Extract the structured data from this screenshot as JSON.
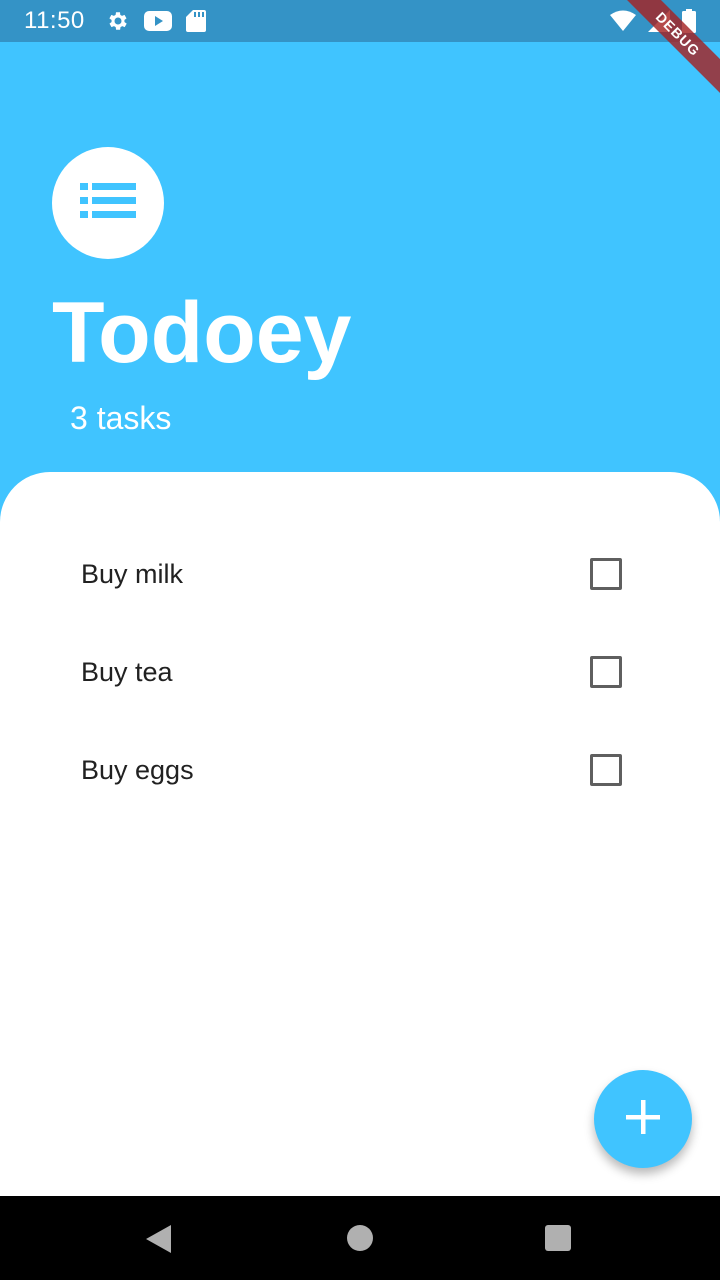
{
  "status_bar": {
    "time": "11:50",
    "left_icons": [
      "settings-icon",
      "youtube-icon",
      "sd-card-icon"
    ],
    "right_icons": [
      "wifi-icon",
      "signal-icon",
      "battery-icon"
    ]
  },
  "debug_banner": "DEBUG",
  "header": {
    "icon": "list-icon",
    "title": "Todoey",
    "subtitle": "3 tasks"
  },
  "tasks": [
    {
      "label": "Buy milk",
      "checked": false
    },
    {
      "label": "Buy tea",
      "checked": false
    },
    {
      "label": "Buy eggs",
      "checked": false
    }
  ],
  "fab": {
    "icon": "add-icon"
  },
  "colors": {
    "primary": "#40C4FF",
    "status_bar": "#3493C6",
    "sheet": "#FFFFFF",
    "task_text": "#212121"
  },
  "nav_bar": {
    "icons": [
      "back-icon",
      "home-icon",
      "recents-icon"
    ]
  }
}
